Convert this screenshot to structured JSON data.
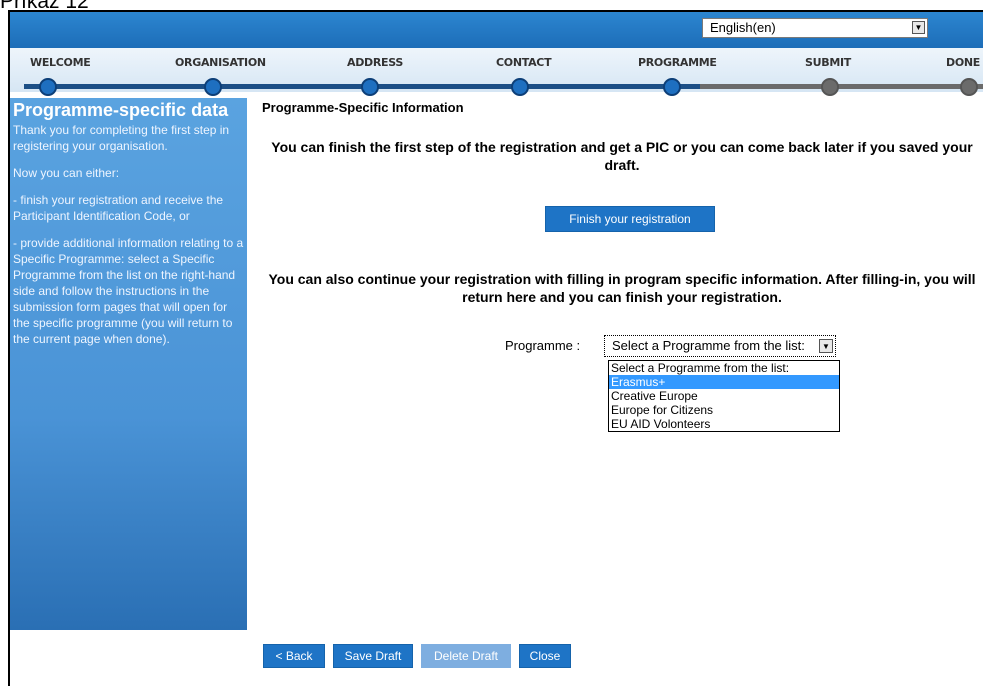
{
  "caption": "Příkaz 12",
  "language": {
    "selected": "English(en)"
  },
  "steps": [
    {
      "label": "WELCOME",
      "state": "done"
    },
    {
      "label": "ORGANISATION",
      "state": "done"
    },
    {
      "label": "ADDRESS",
      "state": "done"
    },
    {
      "label": "CONTACT",
      "state": "done"
    },
    {
      "label": "PROGRAMME",
      "state": "done"
    },
    {
      "label": "SUBMIT",
      "state": "todo"
    },
    {
      "label": "DONE",
      "state": "todo"
    }
  ],
  "sidebar": {
    "title": "Programme-specific data",
    "paragraphs": [
      "Thank you for completing the first step in registering your organisation.",
      "Now you can either:",
      "- finish your registration and receive the Participant Identification Code, or",
      "- provide additional information relating to a Specific Programme: select a Specific Programme from the list on the right-hand side and follow the instructions in the submission form pages that will open for the specific programme (you will return to the current page when done)."
    ]
  },
  "main": {
    "section_title": "Programme-Specific Information",
    "message1": "You can finish the first step of the registration and get a PIC or you can come back later if you saved your draft.",
    "finish_button": "Finish your registration",
    "message2": "You can also continue your registration with filling in program specific information. After filling-in, you will return here and you can finish your registration.",
    "programme_label": "Programme :",
    "programme_selected": "Select a Programme from the list:",
    "programme_options": [
      {
        "label": "Select a Programme from the list:",
        "highlighted": false
      },
      {
        "label": "Erasmus+",
        "highlighted": true
      },
      {
        "label": "Creative Europe",
        "highlighted": false
      },
      {
        "label": "Europe for Citizens",
        "highlighted": false
      },
      {
        "label": "EU AID Volonteers",
        "highlighted": false
      }
    ]
  },
  "footer": {
    "back": "< Back",
    "save_draft": "Save Draft",
    "delete_draft": "Delete Draft",
    "close": "Close"
  }
}
